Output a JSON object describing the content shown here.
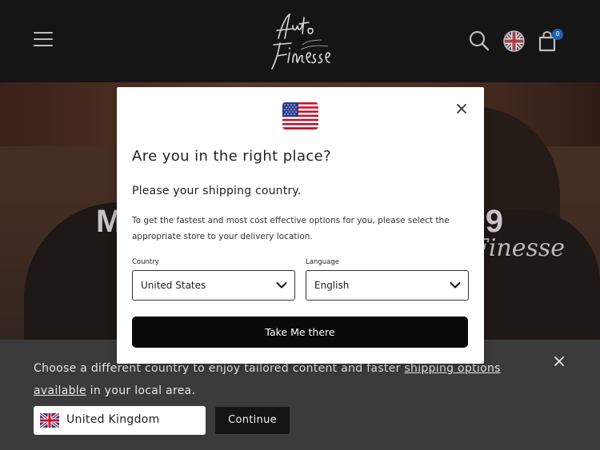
{
  "header": {
    "logo_text": "Auto Finesse the art of detailing",
    "cart_count": "0",
    "icons": [
      "menu-icon",
      "search-icon",
      "uk-flag-icon",
      "shopping-bag-icon"
    ]
  },
  "hero": {
    "headline_left": "M",
    "headline_right": "9",
    "script_text": "Finesse"
  },
  "modal": {
    "flag": "us-flag-icon",
    "title": "Are you in the right place?",
    "subtitle": "Please your shipping country.",
    "description": "To get the fastest and most cost effective options for you, please select the appropriate store to your delivery location.",
    "country_label": "Country",
    "country_value": "United States",
    "language_label": "Language",
    "language_value": "English",
    "cta_label": "Take Me there"
  },
  "banner": {
    "message_prefix": "Choose a different country to enjoy tailored content and faster ",
    "message_link": "shipping options available",
    "message_suffix": " in your local area.",
    "country_value": "United Kingdom",
    "continue_label": "Continue"
  },
  "colors": {
    "header_bg": "#151515",
    "banner_bg": "#3b3b3b",
    "badge": "#1f5eb0",
    "cta_bg": "#0a0a0a"
  }
}
